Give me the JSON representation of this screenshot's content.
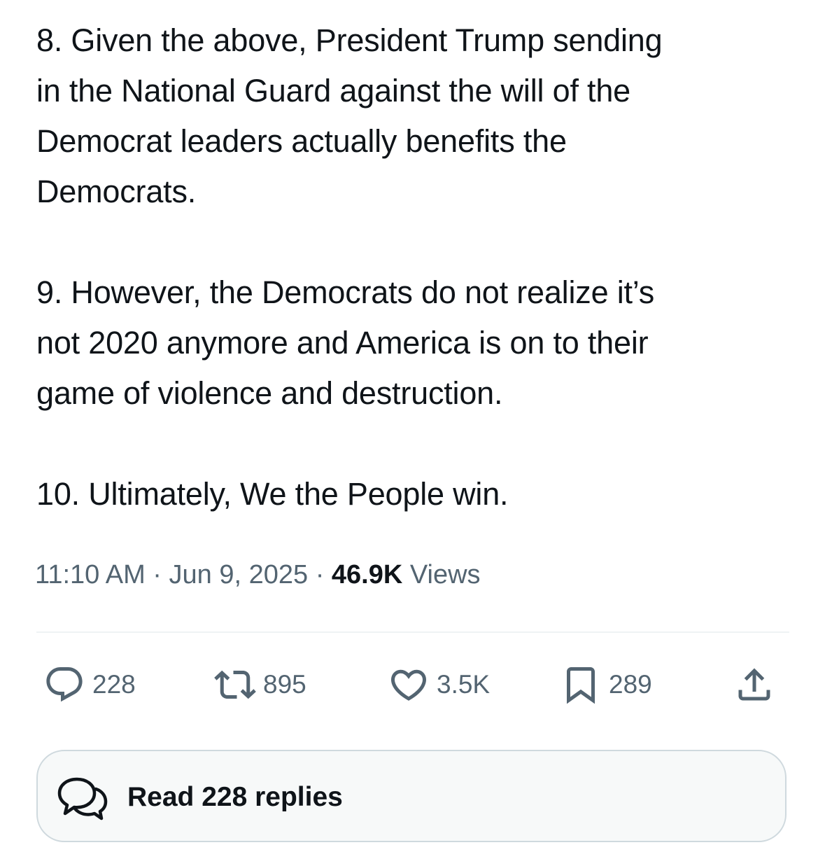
{
  "tweet": {
    "paragraphs": [
      "8. Given the above, President Trump sending\nin the National Guard against the will of the\nDemocrat leaders actually benefits the\nDemocrats.",
      "9. However, the Democrats do not realize it’s\nnot 2020 anymore and America is on to their\ngame of violence and destruction.",
      "10. Ultimately, We the People win."
    ],
    "time": "11:10 AM",
    "date": "Jun 9, 2025",
    "separator": "·",
    "views_count": "46.9K",
    "views_label": "Views"
  },
  "actions": {
    "replies": {
      "count": "228",
      "icon": "reply-icon"
    },
    "reposts": {
      "count": "895",
      "icon": "repost-icon"
    },
    "likes": {
      "count": "3.5K",
      "icon": "heart-icon"
    },
    "bookmarks": {
      "count": "289",
      "icon": "bookmark-icon"
    },
    "share": {
      "icon": "share-icon"
    }
  },
  "read_replies": {
    "label": "Read 228 replies",
    "icon": "conversation-bubbles-icon"
  },
  "colors": {
    "text": "#0f1419",
    "secondary": "#536471",
    "divider": "#eff3f4",
    "button_border": "#cfd9de",
    "button_bg": "#f7f9f9"
  }
}
